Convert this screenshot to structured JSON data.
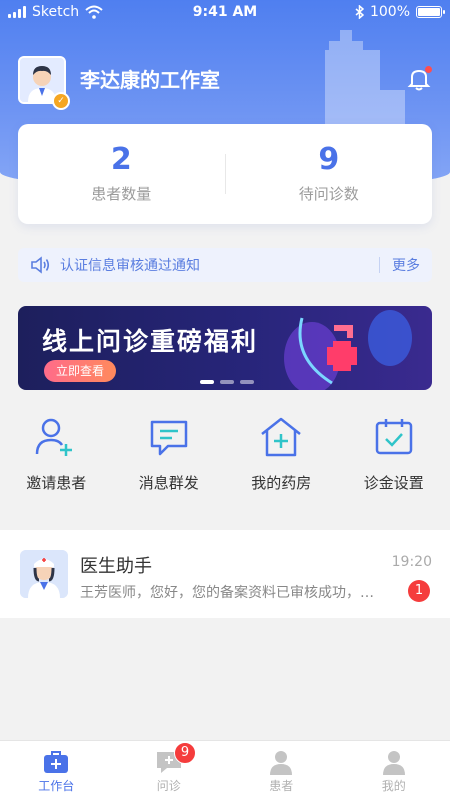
{
  "status_bar": {
    "carrier": "Sketch",
    "time": "9:41 AM",
    "battery": "100%",
    "battery_level": 1.0
  },
  "header": {
    "title": "李达康的工作室",
    "verified_mark": "✓"
  },
  "stats": [
    {
      "value": "2",
      "label": "患者数量"
    },
    {
      "value": "9",
      "label": "待问诊数"
    }
  ],
  "notice": {
    "text": "认证信息审核通过通知",
    "more": "更多"
  },
  "banner": {
    "title": "线上问诊重磅福利",
    "button": "立即查看",
    "slide_count": 3,
    "active_slide": 1
  },
  "quick_actions": [
    {
      "label": "邀请患者",
      "icon": "invite-patient-icon"
    },
    {
      "label": "消息群发",
      "icon": "message-broadcast-icon"
    },
    {
      "label": "我的药房",
      "icon": "pharmacy-icon"
    },
    {
      "label": "诊金设置",
      "icon": "fee-settings-icon"
    }
  ],
  "message": {
    "name": "医生助手",
    "time": "19:20",
    "preview": "王芳医师，您好，您的备案资料已审核成功，可以开始问诊了",
    "unread": "1"
  },
  "tabbar": {
    "items": [
      {
        "label": "工作台",
        "icon": "workbench-icon",
        "active": true
      },
      {
        "label": "问诊",
        "icon": "consult-icon",
        "active": false
      },
      {
        "label": "患者",
        "icon": "patient-icon",
        "active": false
      },
      {
        "label": "我的",
        "icon": "profile-icon",
        "active": false
      }
    ],
    "consult_badge": "9"
  },
  "colors": {
    "primary": "#4a72e8",
    "hero": "#5b87f1",
    "badge": "#f53c3c",
    "verified": "#f5a623"
  }
}
